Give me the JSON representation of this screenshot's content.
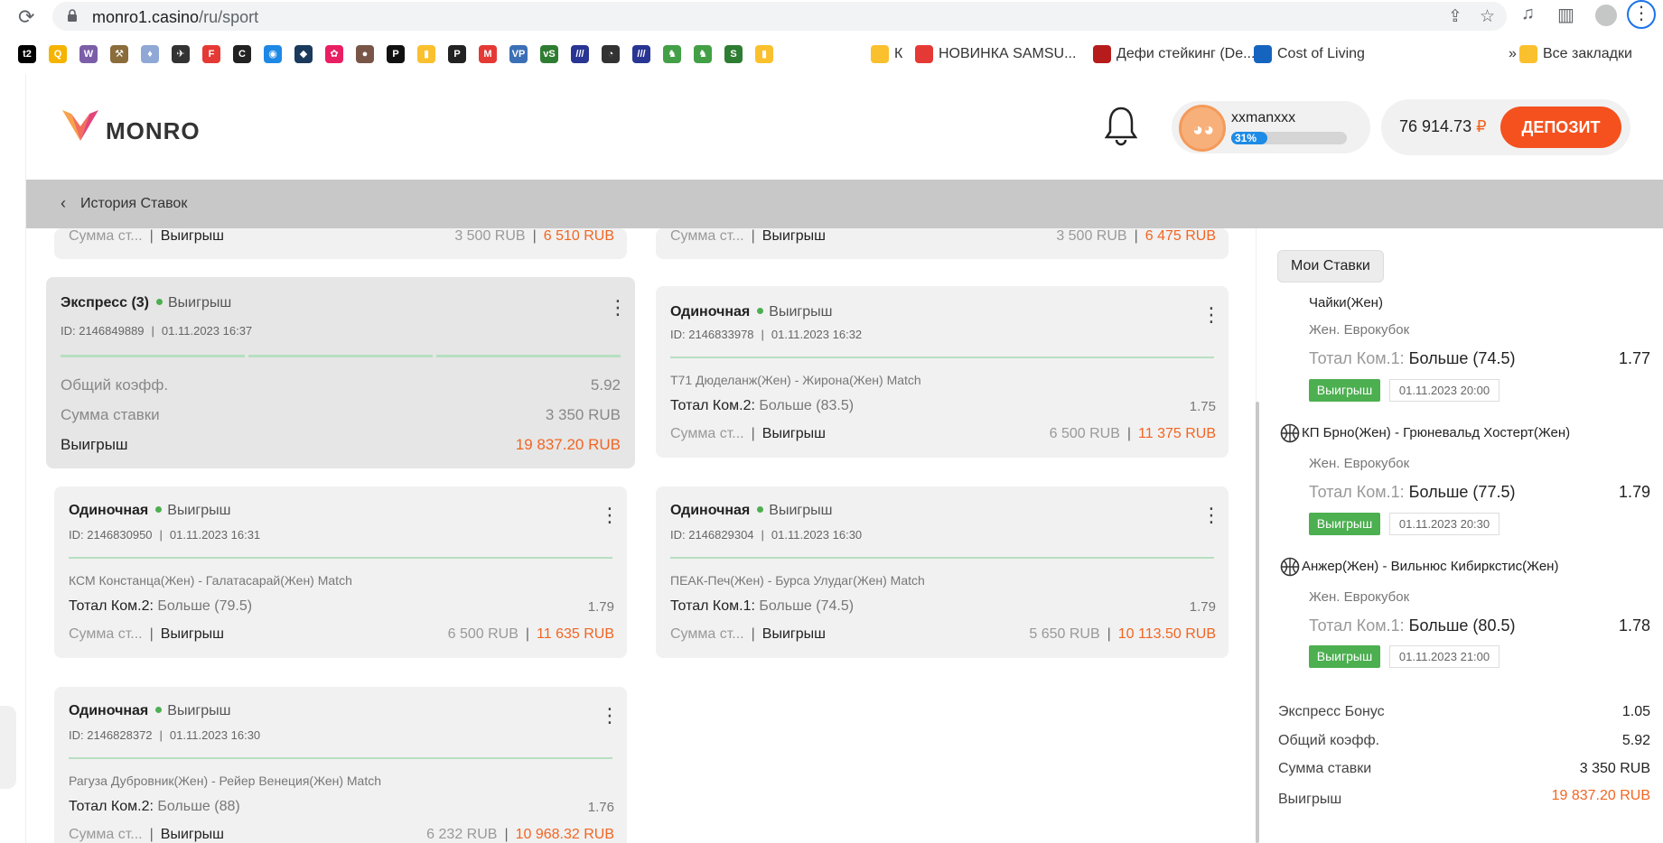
{
  "browser": {
    "url_host": "monro1.casino",
    "url_path": "/ru/sport",
    "bookmarks": [
      {
        "icon": "t2",
        "color": "#000000"
      },
      {
        "icon": "Q",
        "color": "#f5b400"
      },
      {
        "icon": "W",
        "color": "#7b5ea7"
      },
      {
        "icon": "⚒",
        "color": "#8a6d3b"
      },
      {
        "icon": "♦",
        "color": "#8fa8d6"
      },
      {
        "icon": "✈",
        "color": "#333333"
      },
      {
        "icon": "F",
        "color": "#e53935"
      },
      {
        "icon": "C",
        "color": "#222222"
      },
      {
        "icon": "◉",
        "color": "#1e88e5"
      },
      {
        "icon": "◆",
        "color": "#1a3a5c"
      },
      {
        "icon": "✿",
        "color": "#e91e63"
      },
      {
        "icon": "●",
        "color": "#795548"
      },
      {
        "icon": "P",
        "color": "#111111"
      },
      {
        "icon": "▮",
        "color": "#fbc02d"
      },
      {
        "icon": "P",
        "color": "#222222"
      },
      {
        "icon": "M",
        "color": "#e53935"
      },
      {
        "icon": "VP",
        "color": "#3b6fb6"
      },
      {
        "icon": "vS",
        "color": "#2e7d32"
      },
      {
        "icon": "///",
        "color": "#283593"
      },
      {
        "icon": "◔",
        "color": "#333333"
      },
      {
        "icon": "///",
        "color": "#283593"
      },
      {
        "icon": "♞",
        "color": "#43a047"
      },
      {
        "icon": "♞",
        "color": "#43a047"
      },
      {
        "icon": "S",
        "color": "#2e7d32"
      },
      {
        "icon": "▮",
        "color": "#fbc02d"
      }
    ],
    "named_bookmarks": [
      {
        "label": "К",
        "icon_color": "#fbc02d"
      },
      {
        "label": "НОВИНКА SAMSU...",
        "icon_color": "#e53935"
      },
      {
        "label": "Дефи стейкинг (De...",
        "icon_color": "#b71c1c"
      },
      {
        "label": "Cost of Living",
        "icon_color": "#1565c0"
      },
      {
        "label": "Все закладки",
        "icon_color": "#fbc02d"
      }
    ],
    "overflow": "»"
  },
  "header": {
    "logo_text": "MONRO",
    "username": "xxmanxxx",
    "level_progress": 31,
    "level_label": "31%",
    "balance_value": "76 914.73",
    "balance_currency": "₽",
    "deposit_label": "ДЕПОЗИТ"
  },
  "backbar": {
    "title": "История Ставок"
  },
  "cards": {
    "top_left": {
      "stake_label": "Сумма ст...",
      "win_label": "Выигрыш",
      "stake": "3 500 RUB",
      "win": "6 510 RUB"
    },
    "top_right": {
      "stake_label": "Сумма ст...",
      "win_label": "Выигрыш",
      "stake": "3 500 RUB",
      "win": "6 475 RUB"
    },
    "express": {
      "type": "Экспресс (3)",
      "status": "Выигрыш",
      "id": "ID: 2146849889",
      "date": "01.11.2023 16:37",
      "coef_label": "Общий коэфф.",
      "coef": "5.92",
      "stake_label": "Сумма ставки",
      "stake": "3 350 RUB",
      "win_label": "Выигрыш",
      "win": "19 837.20 RUB"
    },
    "single1": {
      "type": "Одиночная",
      "status": "Выигрыш",
      "id": "ID: 2146833978",
      "date": "01.11.2023 16:32",
      "match": "Т71 Дюделанж(Жен) - Жирона(Жен) Match",
      "market": "Тотал Ком.2:",
      "selection": "Больше (83.5)",
      "odds": "1.75",
      "stake_label": "Сумма ст...",
      "win_label": "Выигрыш",
      "stake": "6 500 RUB",
      "win": "11 375 RUB"
    },
    "single2": {
      "type": "Одиночная",
      "status": "Выигрыш",
      "id": "ID: 2146830950",
      "date": "01.11.2023 16:31",
      "match": "КСМ Констанца(Жен) - Галатасарай(Жен) Match",
      "market": "Тотал Ком.2:",
      "selection": "Больше (79.5)",
      "odds": "1.79",
      "stake_label": "Сумма ст...",
      "win_label": "Выигрыш",
      "stake": "6 500 RUB",
      "win": "11 635 RUB"
    },
    "single3": {
      "type": "Одиночная",
      "status": "Выигрыш",
      "id": "ID: 2146829304",
      "date": "01.11.2023 16:30",
      "match": "ПЕАК-Печ(Жен) - Бурса Улудаг(Жен) Match",
      "market": "Тотал Ком.1:",
      "selection": "Больше (74.5)",
      "odds": "1.79",
      "stake_label": "Сумма ст...",
      "win_label": "Выигрыш",
      "stake": "5 650 RUB",
      "win": "10 113.50 RUB"
    },
    "single4": {
      "type": "Одиночная",
      "status": "Выигрыш",
      "id": "ID: 2146828372",
      "date": "01.11.2023 16:30",
      "match": "Рагуза Дубровник(Жен) - Рейер Венеция(Жен) Match",
      "market": "Тотал Ком.2:",
      "selection": "Больше (88)",
      "odds": "1.76",
      "stake_label": "Сумма ст...",
      "win_label": "Выигрыш",
      "stake": "6 232 RUB",
      "win": "10 968.32 RUB"
    }
  },
  "sidebar": {
    "tab_label": "Мои Ставки",
    "legs": [
      {
        "title": "Чайки(Жен)",
        "league": "Жен. Еврокубок",
        "market": "Тотал Ком.1:",
        "selection": "Больше (74.5)",
        "odds": "1.77",
        "badge": "Выигрыш",
        "time": "01.11.2023 20:00"
      },
      {
        "title": "КП Брно(Жен) - Грюневальд Хостерт(Жен)",
        "league": "Жен. Еврокубок",
        "market": "Тотал Ком.1:",
        "selection": "Больше (77.5)",
        "odds": "1.79",
        "badge": "Выигрыш",
        "time": "01.11.2023 20:30"
      },
      {
        "title": "Анжер(Жен) - Вильнюс Кибиркстис(Жен)",
        "league": "Жен. Еврокубок",
        "market": "Тотал Ком.1:",
        "selection": "Больше (80.5)",
        "odds": "1.78",
        "badge": "Выигрыш",
        "time": "01.11.2023 21:00"
      }
    ],
    "summary": {
      "bonus_label": "Экспресс Бонус",
      "bonus": "1.05",
      "coef_label": "Общий коэфф.",
      "coef": "5.92",
      "stake_label": "Сумма ставки",
      "stake": "3 350 RUB",
      "win_label": "Выигрыш",
      "win": "19 837.20 RUB"
    }
  }
}
